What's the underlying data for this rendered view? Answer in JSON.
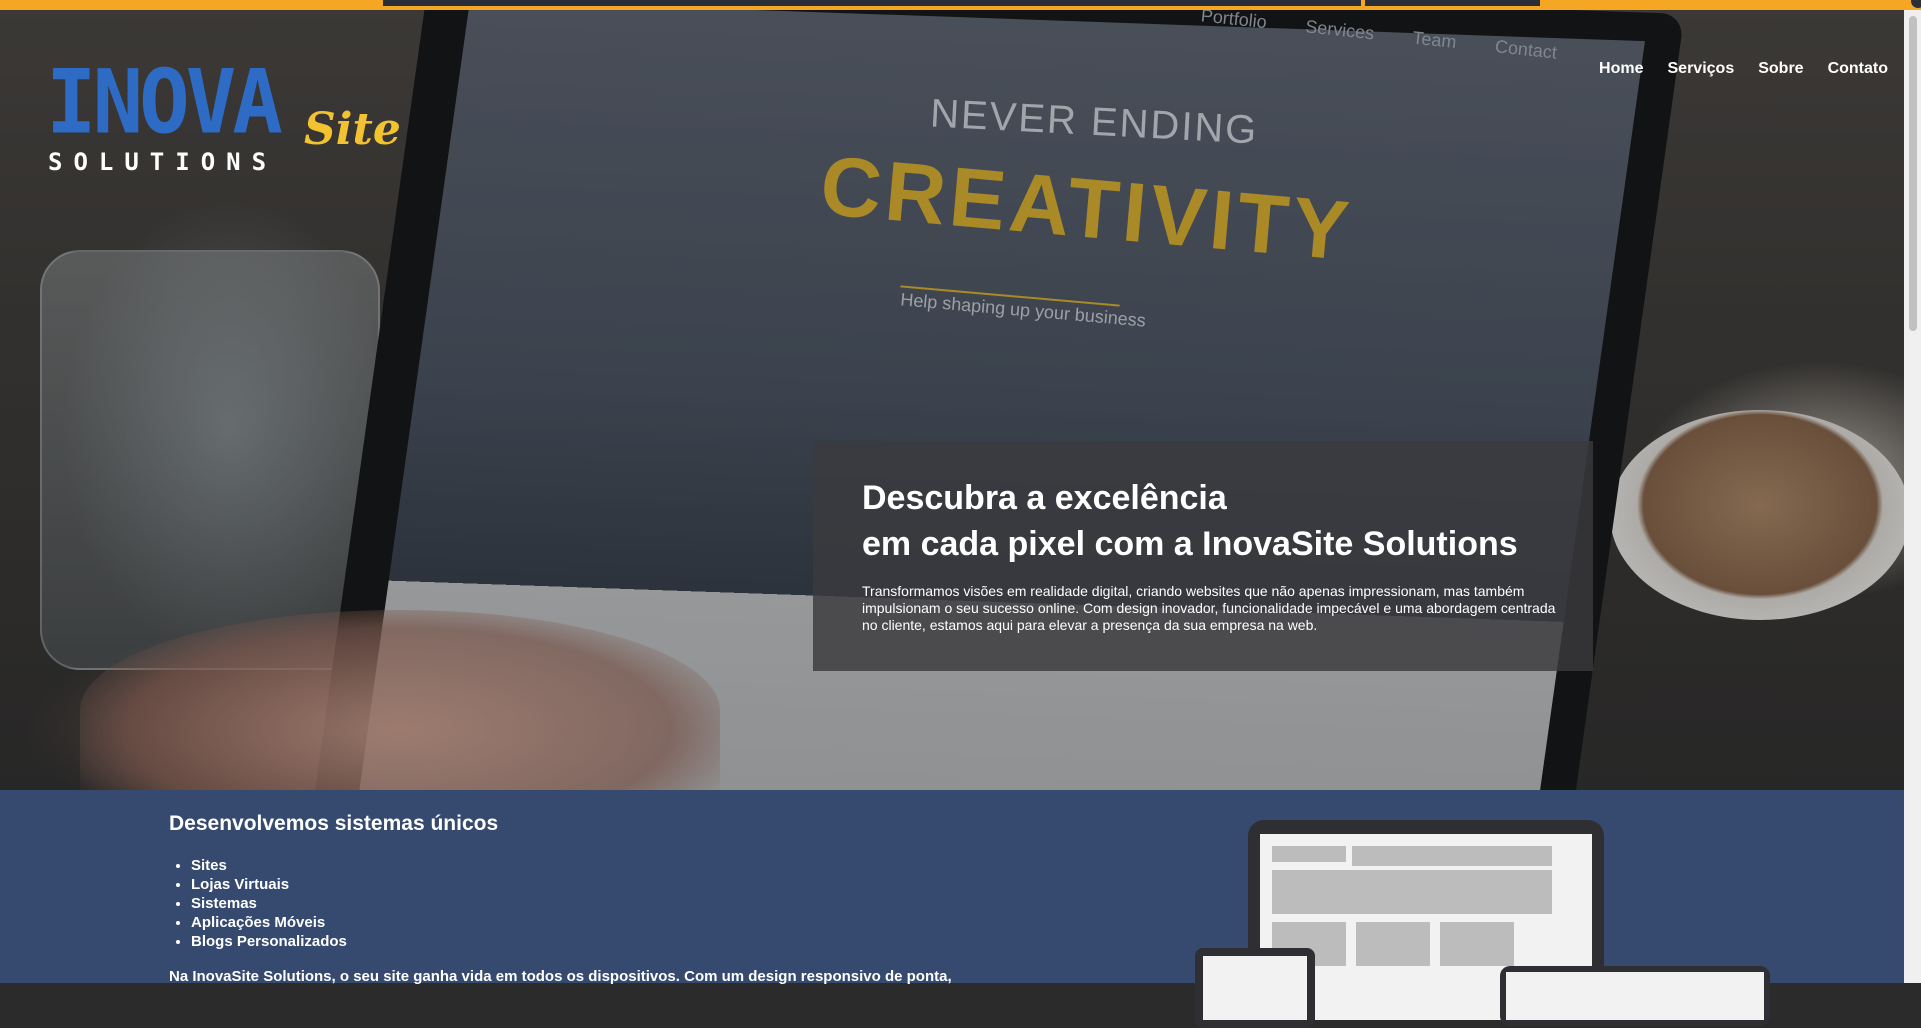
{
  "logo": {
    "inova": "INOVA",
    "site": "Site",
    "solutions": "SOLUTIONS"
  },
  "nav": {
    "items": [
      {
        "label": "Home"
      },
      {
        "label": "Serviços"
      },
      {
        "label": "Sobre"
      },
      {
        "label": "Contato"
      }
    ]
  },
  "hero_image": {
    "never_ending": "NEVER ENDING",
    "creativity": "CREATIVITY",
    "help": "Help shaping up your business",
    "mini_nav": "Portfolio Services Team Contact"
  },
  "hero": {
    "title_line1": "Descubra a excelência",
    "title_line2": "em cada pixel com a InovaSite Solutions",
    "description": "Transformamos visões em realidade digital, criando websites que não apenas impressionam, mas também impulsionam o seu sucesso online. Com design inovador, funcionalidade impecável e uma abordagem centrada no cliente, estamos aqui para elevar a presença da sua empresa na web."
  },
  "services": {
    "title": "Desenvolvemos sistemas únicos",
    "items": [
      {
        "label": "Sites"
      },
      {
        "label": "Lojas Virtuais"
      },
      {
        "label": "Sistemas"
      },
      {
        "label": "Aplicações Móveis"
      },
      {
        "label": "Blogs Personalizados"
      }
    ],
    "text": "Na InovaSite Solutions, o seu site ganha vida em todos os dispositivos. Com um design responsivo de ponta,"
  },
  "colors": {
    "accent_orange": "#f5a623",
    "logo_blue": "#2d6bc4",
    "logo_yellow": "#f2c230",
    "section_blue": "#354a6e"
  }
}
